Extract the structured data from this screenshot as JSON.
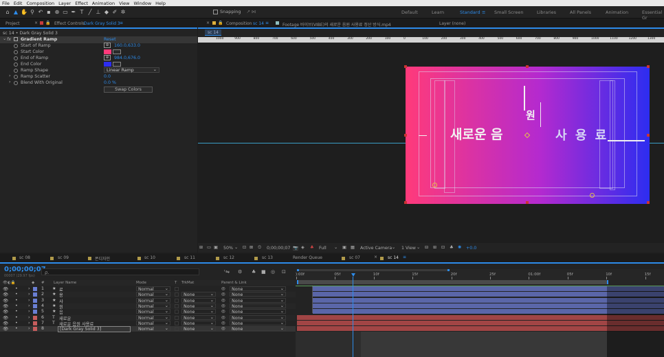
{
  "menu": [
    "File",
    "Edit",
    "Composition",
    "Layer",
    "Effect",
    "Animation",
    "View",
    "Window",
    "Help"
  ],
  "toolbar": {
    "snapping_label": "Snapping",
    "workspaces": [
      "Default",
      "Learn",
      "Standard",
      "Small Screen",
      "Libraries",
      "All Panels",
      "Animation",
      "Essential Gr"
    ],
    "active_workspace": "Standard"
  },
  "left_panel": {
    "project_tab": "Project",
    "effect_tab_prefix": "Effect Controls",
    "effect_tab_target": "Dark Gray Solid 3",
    "breadcrumb": "sc 14 • Dark Gray Solid 3",
    "effect_name": "Gradient Ramp",
    "reset_label": "Reset",
    "params": [
      {
        "label": "Start of Ramp",
        "value": "160.0,633.0"
      },
      {
        "label": "Start Color",
        "color": "#ff3a7a"
      },
      {
        "label": "End of Ramp",
        "value": "984.0,676.0"
      },
      {
        "label": "End Color",
        "color": "#2d2df0"
      },
      {
        "label": "Ramp Shape",
        "value": "Linear Ramp"
      },
      {
        "label": "Ramp Scatter",
        "value": "0.0"
      },
      {
        "label": "Blend With Original",
        "value": "0.0 %"
      }
    ],
    "swap_label": "Swap Colors"
  },
  "comp_panel": {
    "comp_tab_prefix": "Composition",
    "comp_tab_name": "sc 14",
    "footage_tab": "Footage 바이브(VIBE)의 새로운 음원 사용료 정산 방식.mp4",
    "layer_tab": "Layer (none)",
    "sub_tab": "sc 14",
    "ruler_labels": [
      "1000",
      "900",
      "800",
      "700",
      "600",
      "500",
      "400",
      "300",
      "200",
      "100",
      "0",
      "100",
      "200",
      "300",
      "400",
      "500",
      "600",
      "700",
      "800",
      "900",
      "1000",
      "1100",
      "1200",
      "1300"
    ],
    "text_main": "새로운 음",
    "text_won": "원",
    "text_right": "사 용 료",
    "toolbar": {
      "zoom": "50%",
      "timecode": "0;00;00;07",
      "resolution": "Full",
      "camera": "Active Camera",
      "view": "1 View",
      "exposure": "+0.0"
    }
  },
  "timeline": {
    "tabs": [
      "sc 08",
      "sc 09",
      "폰디자인",
      "sc 10",
      "sc 11",
      "sc 12",
      "sc 13",
      "Render Queue",
      "sc 07",
      "sc 14"
    ],
    "active_tab": "sc 14",
    "timecode": "0;00;00;07",
    "frame_info": "00007 (29.97 fps)",
    "search_placeholder": "ρ.",
    "headers": {
      "num": "#",
      "layer_name": "Layer Name",
      "mode": "Mode",
      "t": "T",
      "trkmat": "TrkMat",
      "parent": "Parent & Link"
    },
    "ruler": [
      "):00f",
      "05f",
      "10f",
      "15f",
      "20f",
      "25f",
      "01:00f",
      "05f",
      "10f",
      "15f"
    ],
    "layers": [
      {
        "num": "1",
        "type": "★",
        "name": "료",
        "mode": "Normal",
        "trkmat": "",
        "parent": "None",
        "color": "#6a7fd4"
      },
      {
        "num": "2",
        "type": "★",
        "name": "용",
        "mode": "Normal",
        "trkmat": "None",
        "parent": "None",
        "color": "#6a7fd4"
      },
      {
        "num": "3",
        "type": "★",
        "name": "사",
        "mode": "Normal",
        "trkmat": "None",
        "parent": "None",
        "color": "#6a7fd4"
      },
      {
        "num": "4",
        "type": "★",
        "name": "원",
        "mode": "Normal",
        "trkmat": "None",
        "parent": "None",
        "color": "#6a7fd4"
      },
      {
        "num": "5",
        "type": "★",
        "name": "음",
        "mode": "Normal",
        "trkmat": "None",
        "parent": "None",
        "color": "#6a7fd4"
      },
      {
        "num": "6",
        "type": "T",
        "name": "새로운",
        "mode": "Normal",
        "trkmat": "None",
        "parent": "None",
        "color": "#c75d5d"
      },
      {
        "num": "7",
        "type": "T",
        "name": "새로운 음원 사용료",
        "mode": "Normal",
        "trkmat": "None",
        "parent": "None",
        "color": "#c75d5d"
      },
      {
        "num": "8",
        "type": "",
        "name": "[Dark Gray Solid 3]",
        "mode": "Normal",
        "trkmat": "None",
        "parent": "None",
        "color": "#c75d5d"
      }
    ]
  },
  "colors": {
    "accent": "#2d8ceb",
    "gradient_start": "#ff3a7a",
    "gradient_end": "#2d2df0"
  }
}
